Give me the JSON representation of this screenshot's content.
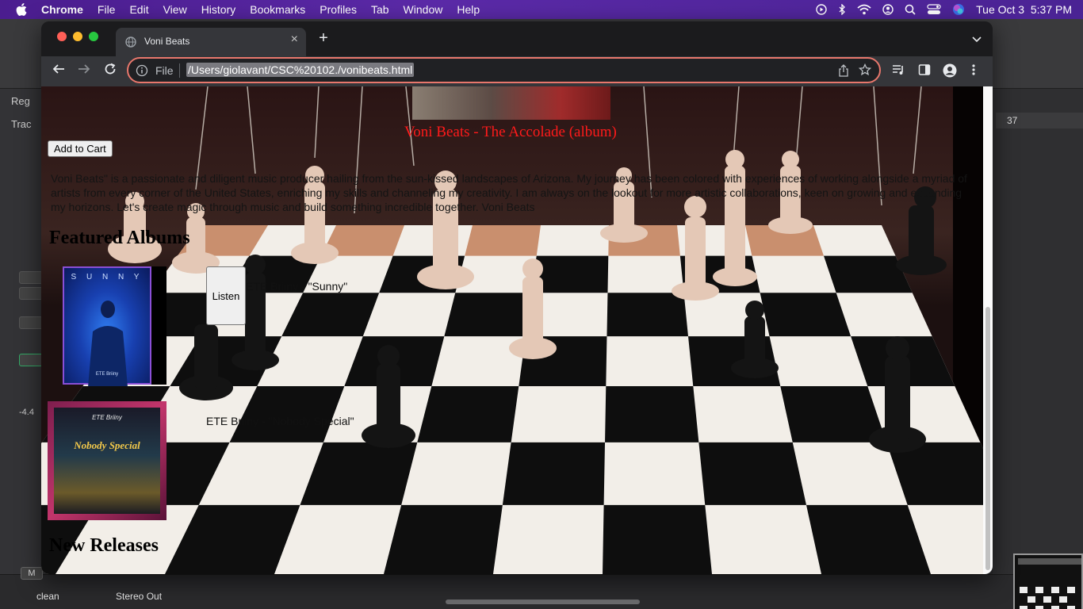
{
  "menubar": {
    "app_name": "Chrome",
    "items": [
      "File",
      "Edit",
      "View",
      "History",
      "Bookmarks",
      "Profiles",
      "Tab",
      "Window",
      "Help"
    ],
    "datetime": "Tue Oct 3  5:37 PM"
  },
  "browser": {
    "tab_title": "Voni Beats",
    "address_scheme": "File",
    "address_url": "/Users/giolavant/CSC%20102./vonibeats.html"
  },
  "page": {
    "album_heading": "Voni Beats - The Accolade (album)",
    "add_to_cart_label": "Add to Cart",
    "bio": "Voni Beats\" is a passionate and diligent music producer hailing from the sun-kissed landscapes of Arizona. My journey has been colored with experiences of working alongside a myriad of artists from every corner of the United States, enriching my skills and channeling my creativity. I am always on the lookout for more artistic collaborations, keen on growing and expanding my horizons. Let's create magic through music and build something incredible together. Voni Beats",
    "featured_heading": "Featured Albums",
    "albums": [
      {
        "track": "ETE Briiny - \"Sunny\"",
        "cover_word": "S U N N Y",
        "cover_artist": "ETE Briiny"
      },
      {
        "track": "ETE Briiny - \"Nobody Special\"",
        "cover_title": "Nobody Special",
        "cover_artist": "ETE Briiny"
      }
    ],
    "listen_label": "Listen",
    "new_releases_heading": "New Releases"
  },
  "daw": {
    "left_labels": [
      "Reg",
      "Trac"
    ],
    "ruler_bar": "37",
    "level_readout": "-4.4",
    "mute_label": "M",
    "channel_left": "clean",
    "channel_right": "Stereo Out"
  },
  "colors": {
    "menubar": "#4b1d8f",
    "album_heading": "#ff1a1a",
    "omnibox_border": "#e8776c"
  }
}
